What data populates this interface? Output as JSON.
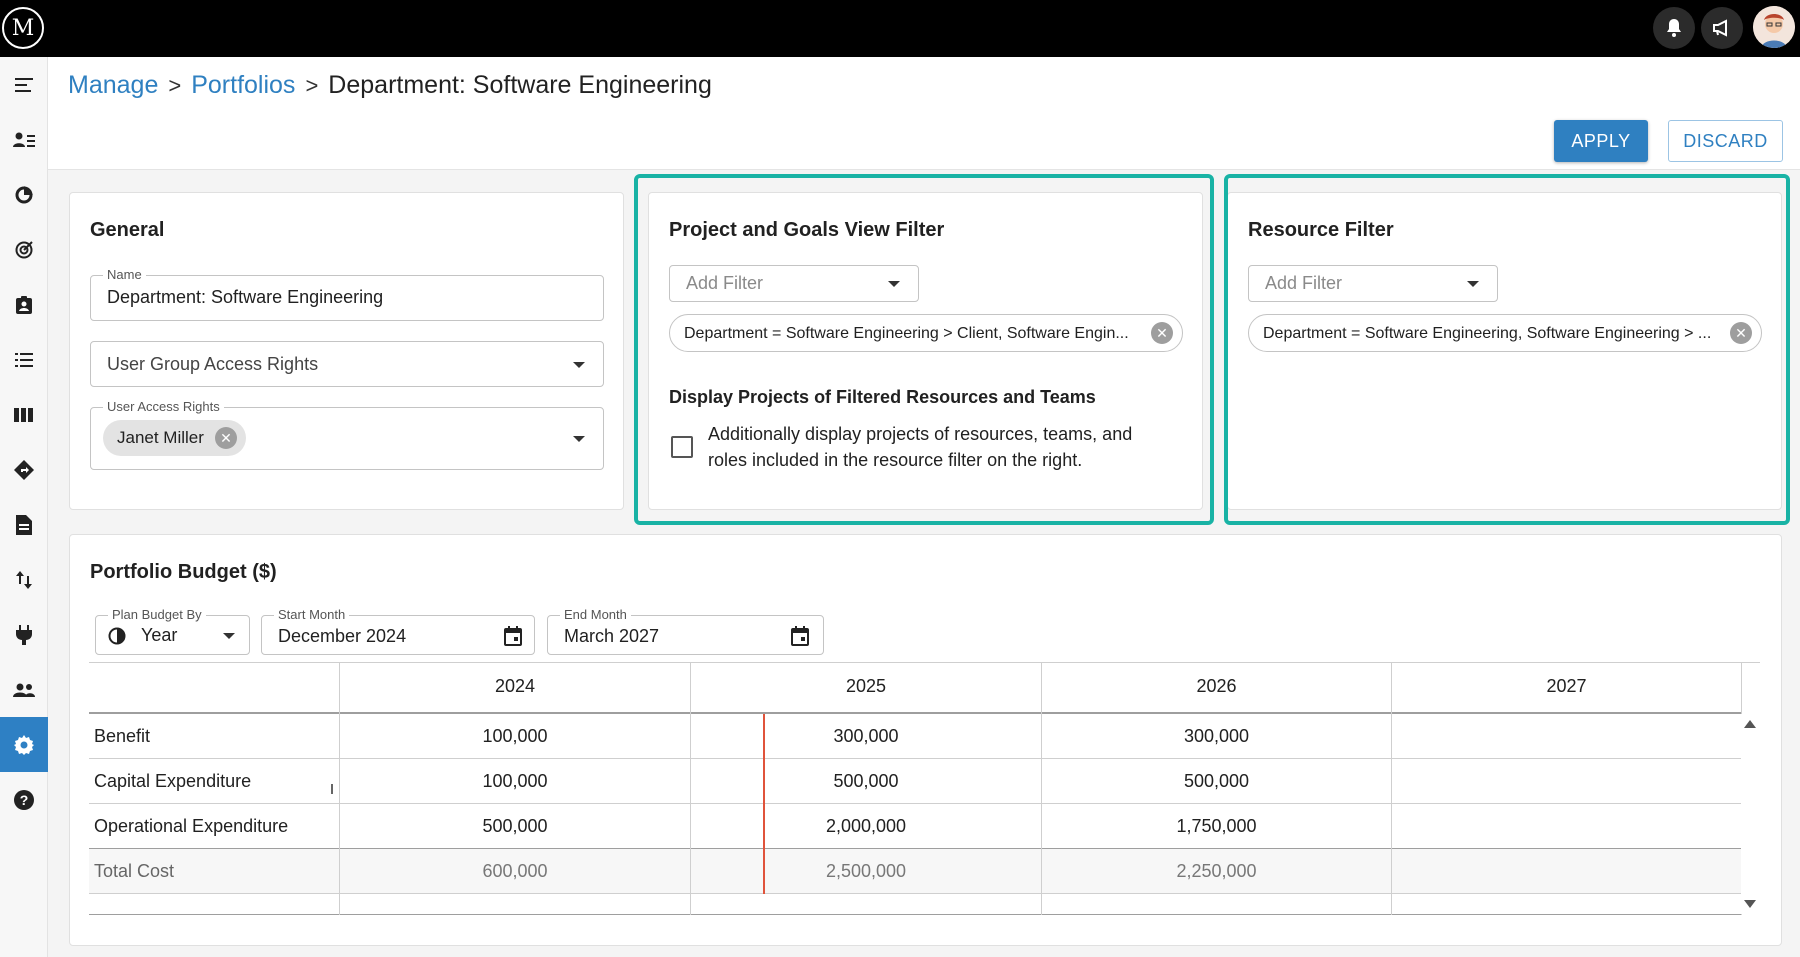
{
  "topbar": {
    "logo_text": "M",
    "icons": [
      "bell-icon",
      "megaphone-icon"
    ]
  },
  "sidebar": {
    "items": [
      {
        "name": "menu-icon"
      },
      {
        "name": "people-list-icon"
      },
      {
        "name": "pie-chart-icon"
      },
      {
        "name": "target-icon"
      },
      {
        "name": "badge-icon"
      },
      {
        "name": "list-icon"
      },
      {
        "name": "columns-icon"
      },
      {
        "name": "directions-icon"
      },
      {
        "name": "document-icon"
      },
      {
        "name": "sort-arrows-icon"
      },
      {
        "name": "plug-icon"
      },
      {
        "name": "group-icon"
      },
      {
        "name": "settings-icon",
        "active": true
      },
      {
        "name": "help-icon"
      }
    ]
  },
  "breadcrumb": {
    "manage": "Manage",
    "portfolios": "Portfolios",
    "current": "Department: Software Engineering",
    "separator": ">"
  },
  "actions": {
    "apply": "APPLY",
    "discard": "DISCARD"
  },
  "general": {
    "title": "General",
    "name_label": "Name",
    "name_value": "Department: Software Engineering",
    "group_access_placeholder": "User Group Access Rights",
    "user_access_label": "User Access Rights",
    "user_chip": "Janet Miller"
  },
  "project_filter": {
    "title": "Project and Goals View Filter",
    "add_filter_placeholder": "Add Filter",
    "chip": "Department = Software Engineering > Client, Software Engin...",
    "display_title": "Display Projects of Filtered Resources and Teams",
    "checkbox_label": "Additionally display projects of resources, teams, and roles included in the resource filter on the right.",
    "checkbox_checked": false
  },
  "resource_filter": {
    "title": "Resource Filter",
    "add_filter_placeholder": "Add Filter",
    "chip": "Department = Software Engineering, Software Engineering > ..."
  },
  "budget": {
    "title": "Portfolio Budget ($)",
    "plan_by_label": "Plan Budget By",
    "plan_by_value": "Year",
    "start_label": "Start Month",
    "start_value": "December 2024",
    "end_label": "End Month",
    "end_value": "March 2027",
    "columns": [
      "2024",
      "2025",
      "2026",
      "2027"
    ],
    "rows": [
      {
        "label": "Benefit",
        "values": [
          "100,000",
          "300,000",
          "300,000",
          ""
        ]
      },
      {
        "label": "Capital Expenditure",
        "values": [
          "100,000",
          "500,000",
          "500,000",
          ""
        ]
      },
      {
        "label": "Operational Expenditure",
        "values": [
          "500,000",
          "2,000,000",
          "1,750,000",
          ""
        ]
      },
      {
        "label": "Total Cost",
        "values": [
          "600,000",
          "2,500,000",
          "2,250,000",
          ""
        ]
      }
    ]
  },
  "colors": {
    "accent": "#2f80c1",
    "highlight": "#19b3a5",
    "today_line": "#e0533b"
  }
}
